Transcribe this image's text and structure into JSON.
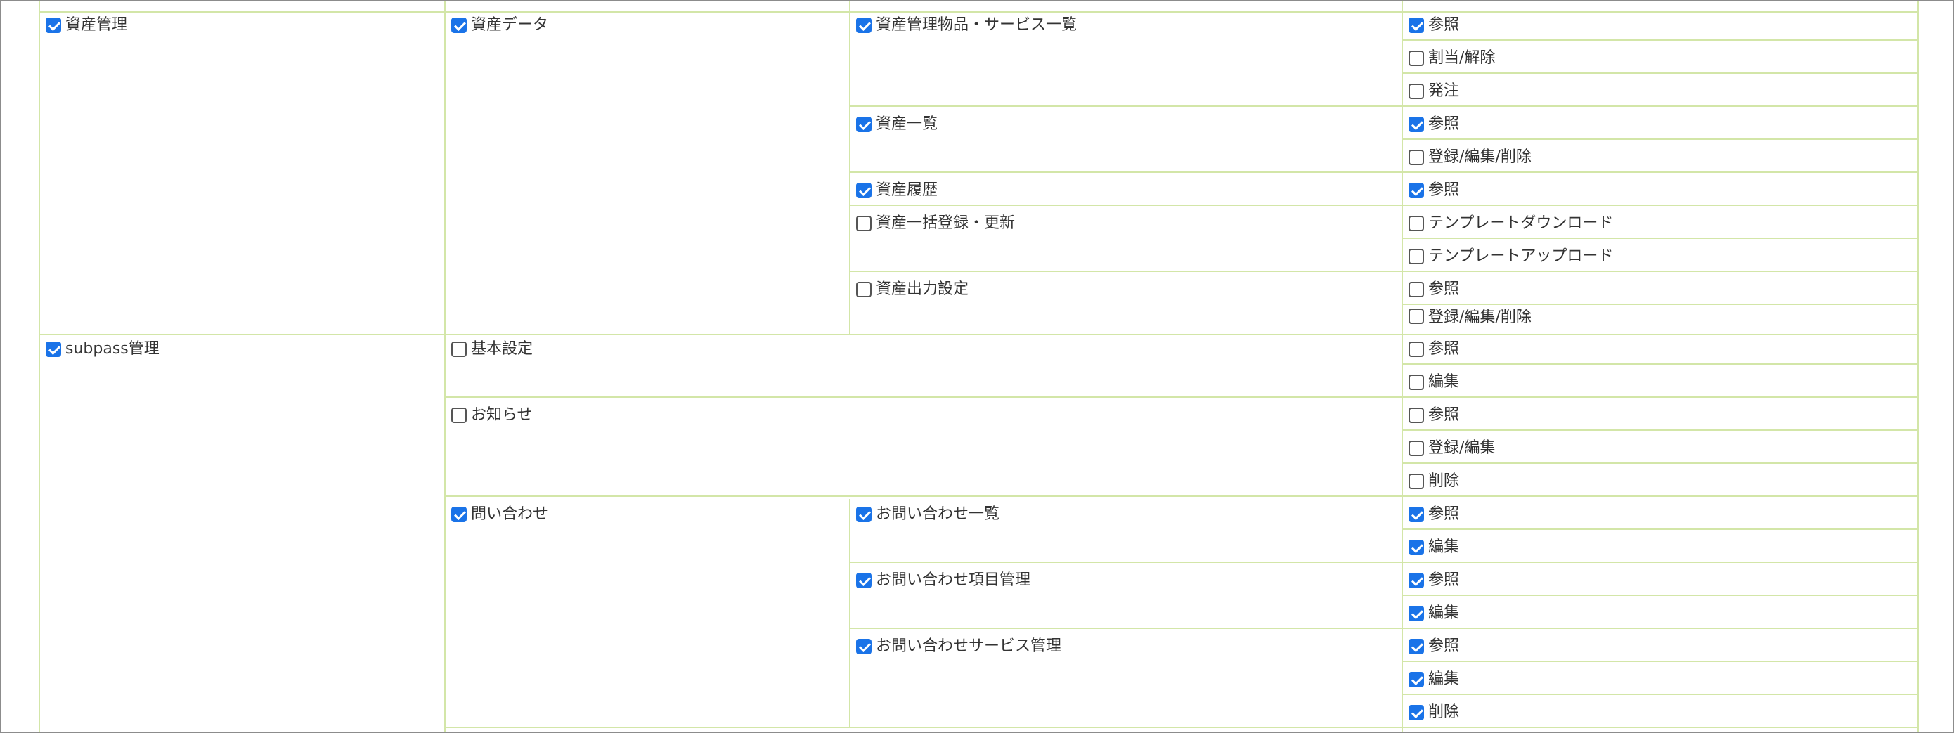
{
  "colors": {
    "grid_line": "#d3e6a8",
    "check_on": "#1a73e8",
    "frame_border": "#8c8c8c",
    "text": "#333333"
  },
  "icons": {
    "checked": "checkbox-checked-icon",
    "unchecked": "checkbox-unchecked-icon"
  },
  "groups": [
    {
      "name": "資産管理",
      "checked": true,
      "subs": [
        {
          "name": "資産データ",
          "checked": true,
          "features": [
            {
              "name": "資産管理物品・サービス一覧",
              "checked": true,
              "perms": [
                {
                  "label": "参照",
                  "checked": true
                },
                {
                  "label": "割当/解除",
                  "checked": false
                },
                {
                  "label": "発注",
                  "checked": false
                }
              ]
            },
            {
              "name": "資産一覧",
              "checked": true,
              "perms": [
                {
                  "label": "参照",
                  "checked": true
                },
                {
                  "label": "登録/編集/削除",
                  "checked": false
                }
              ]
            },
            {
              "name": "資産履歴",
              "checked": true,
              "perms": [
                {
                  "label": "参照",
                  "checked": true
                }
              ]
            },
            {
              "name": "資産一括登録・更新",
              "checked": false,
              "perms": [
                {
                  "label": "テンプレートダウンロード",
                  "checked": false
                },
                {
                  "label": "テンプレートアップロード",
                  "checked": false
                }
              ]
            },
            {
              "name": "資産出力設定",
              "checked": false,
              "perms": [
                {
                  "label": "参照",
                  "checked": false
                },
                {
                  "label": "登録/編集/削除",
                  "checked": false
                }
              ]
            }
          ]
        }
      ]
    },
    {
      "name": "subpass管理",
      "checked": true,
      "subs": [
        {
          "name": "基本設定",
          "checked": false,
          "perms": [
            {
              "label": "参照",
              "checked": false
            },
            {
              "label": "編集",
              "checked": false
            }
          ]
        },
        {
          "name": "お知らせ",
          "checked": false,
          "perms": [
            {
              "label": "参照",
              "checked": false
            },
            {
              "label": "登録/編集",
              "checked": false
            },
            {
              "label": "削除",
              "checked": false
            }
          ]
        },
        {
          "name": "問い合わせ",
          "checked": true,
          "features": [
            {
              "name": "お問い合わせ一覧",
              "checked": true,
              "perms": [
                {
                  "label": "参照",
                  "checked": true
                },
                {
                  "label": "編集",
                  "checked": true
                }
              ]
            },
            {
              "name": "お問い合わせ項目管理",
              "checked": true,
              "perms": [
                {
                  "label": "参照",
                  "checked": true
                },
                {
                  "label": "編集",
                  "checked": true
                }
              ]
            },
            {
              "name": "お問い合わせサービス管理",
              "checked": true,
              "perms": [
                {
                  "label": "参照",
                  "checked": true
                },
                {
                  "label": "編集",
                  "checked": true
                },
                {
                  "label": "削除",
                  "checked": true
                }
              ]
            }
          ]
        }
      ]
    }
  ]
}
